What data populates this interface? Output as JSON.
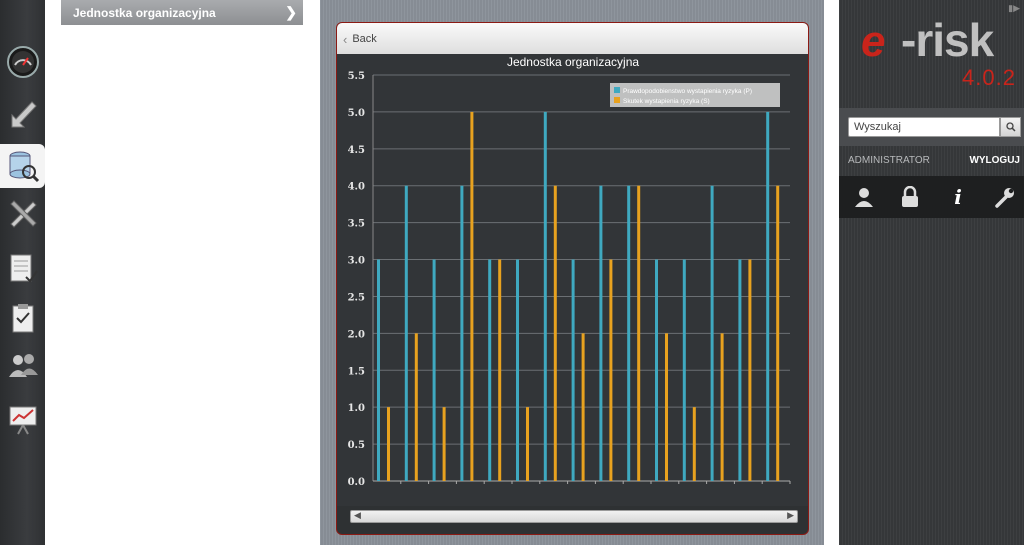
{
  "nav": {
    "item_label": "Jednostka organizacyjna"
  },
  "panel": {
    "back_label": "Back"
  },
  "chart_data": {
    "type": "bar",
    "title": "Jednostka organizacyjna",
    "ylim": [
      0,
      5.5
    ],
    "y_ticks": [
      "0.0",
      "0.5",
      "1.0",
      "1.5",
      "2.0",
      "2.5",
      "3.0",
      "3.5",
      "4.0",
      "4.5",
      "5.0",
      "5.5"
    ],
    "grid": true,
    "legend_position": "top-right",
    "series": [
      {
        "name": "Prawdopodobienstwo wystapienia ryzyka (P)",
        "color": "#3fa9c0",
        "values": [
          3,
          4,
          3,
          4,
          3,
          3,
          5,
          3,
          4,
          4,
          3,
          3,
          4,
          3,
          5
        ]
      },
      {
        "name": "Skutek wystapienia ryzyka (S)",
        "color": "#e8a21f",
        "values": [
          1,
          2,
          1,
          5,
          3,
          1,
          4,
          2,
          3,
          4,
          2,
          1,
          2,
          3,
          4
        ]
      }
    ]
  },
  "sidebar_icons": [
    "dashboard-gauge-icon",
    "arrow-icon",
    "database-search-icon",
    "tools-icon",
    "checklist-icon",
    "clipboard-icon",
    "users-icon",
    "presentation-chart-icon"
  ],
  "right": {
    "logo_e": "e",
    "logo_text": "-risk",
    "version": "4.0.2",
    "search_placeholder": "Wyszukaj",
    "user_label": "ADMINISTRATOR",
    "logout_label": "WYLOGUJ"
  },
  "colors": {
    "brand_red": "#c9241b",
    "panel_border": "#8b1a14"
  }
}
